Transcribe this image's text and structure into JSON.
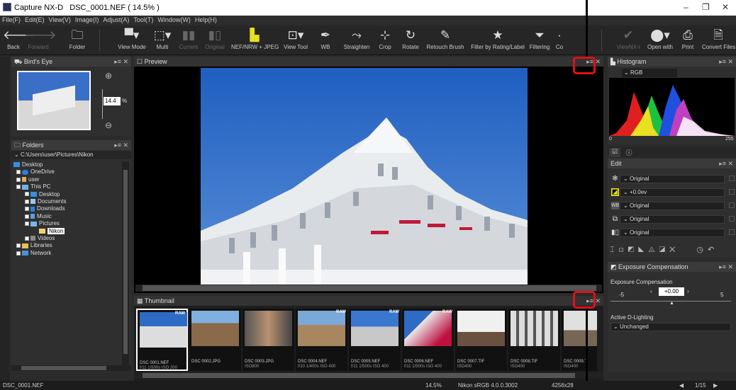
{
  "titlebar": {
    "app": "Capture NX-D",
    "file": "DSC_0001.NEF ( 14.5% )",
    "min": "–",
    "max": "❐",
    "close": "✕"
  },
  "menu": [
    "File(F)",
    "Edit(E)",
    "View(V)",
    "Image(I)",
    "Adjust(A)",
    "Tool(T)",
    "Window(W)",
    "Help(H)"
  ],
  "toolbar": {
    "back": "Back",
    "forward": "Forward",
    "folder": "Folder",
    "view_mode": "View Mode",
    "multi": "Multi",
    "current": "Current",
    "original": "Original",
    "nef_jpeg": "NEF/NRW + JPEG",
    "view_tool": "View Tool",
    "wb": "WB",
    "straighten": "Straighten",
    "crop": "Crop",
    "rotate": "Rotate",
    "retouch": "Retouch Brush",
    "filter_rating": "Filter by Rating/Label",
    "filtering": "Filtering",
    "color_control": "Co",
    "viewnx": "ViewNX-i",
    "open_with": "Open with",
    "print": "Print",
    "convert": "Convert Files"
  },
  "birdseye": {
    "title": "Bird's Eye",
    "zoom_value": "14.4",
    "zoom_unit": "%"
  },
  "folders": {
    "title": "Folders",
    "path": "C:\\Users\\user\\Pictures\\Nikon",
    "items": [
      "Desktop",
      "OneDrive",
      "user",
      "This PC",
      "Desktop",
      "Documents",
      "Downloads",
      "Music",
      "Pictures",
      "Nikon",
      "Videos",
      "Libraries",
      "Network"
    ]
  },
  "preview": {
    "title": "Preview"
  },
  "thumbnail": {
    "title": "Thumbnail",
    "items": [
      {
        "raw": "RAW",
        "name": "DSC 0001.NEF",
        "meta": "f/11 1/500s ISO 200"
      },
      {
        "raw": "",
        "name": "DSC 0002.JPG",
        "meta": ""
      },
      {
        "raw": "",
        "name": "DSC 0003.JPG",
        "meta": "ISO800"
      },
      {
        "raw": "RAW",
        "name": "DSC 0004.NEF",
        "meta": "f/10 1/400s ISO 400"
      },
      {
        "raw": "RAW",
        "name": "DSC 0005.NEF",
        "meta": "f/11 1/500s ISO 400"
      },
      {
        "raw": "RAW",
        "name": "DSC 0006.NEF",
        "meta": "f/11 1/500s ISO 400"
      },
      {
        "raw": "",
        "name": "DSC 0007.TIF",
        "meta": "ISO400"
      },
      {
        "raw": "",
        "name": "DSC 0008.TIF",
        "meta": "ISO400"
      },
      {
        "raw": "",
        "name": "DSC 0009.T",
        "meta": "ISO400"
      }
    ]
  },
  "histogram": {
    "title": "Histogram",
    "channel": "RGB",
    "min": "0",
    "max": "255"
  },
  "edit": {
    "title": "Edit",
    "rows": [
      "Original",
      "+0.0ev",
      "Original",
      "Original",
      "Original"
    ]
  },
  "exposure": {
    "title": "Exposure Compensation",
    "label": "Exposure Compensation",
    "min": "-5",
    "value": "+0.00",
    "max": "5",
    "adl_label": "Active D-Lighting",
    "adl_value": "Unchanged"
  },
  "status": {
    "file": "DSC_0001.NEF",
    "zoom": "14.5%",
    "profile": "Nikon sRGB 4.0.0.3002",
    "size": "4256x28",
    "page": "1/15"
  },
  "colors": {
    "accent": "#e0101a",
    "sky": "#2e6bc4",
    "selection": "#f5d26a"
  }
}
